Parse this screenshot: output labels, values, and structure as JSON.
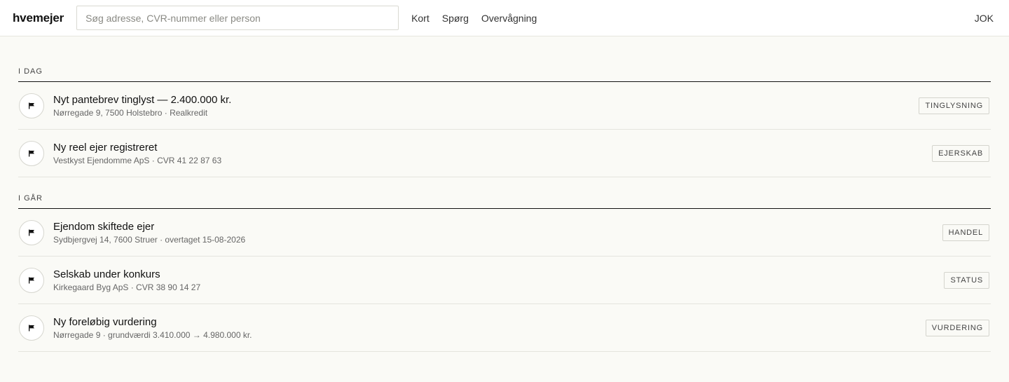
{
  "app": {
    "logo": "hvemejer",
    "search_placeholder": "Søg adresse, CVR-nummer eller person",
    "nav": [
      "Kort",
      "Spørg",
      "Overvågning"
    ],
    "user_initials": "JOK"
  },
  "groups": [
    {
      "label": "I DAG",
      "items": [
        {
          "title": "Nyt pantebrev tinglyst — 2.400.000 kr.",
          "sub": "Nørregade 9, 7500 Holstebro · Realkredit",
          "tag": "TINGLYSNING",
          "icon": "flag-icon"
        },
        {
          "title": "Ny reel ejer registreret",
          "sub": "Vestkyst Ejendomme ApS · CVR 41 22 87 63",
          "tag": "EJERSKAB",
          "icon": "flag-icon"
        }
      ]
    },
    {
      "label": "I GÅR",
      "items": [
        {
          "title": "Ejendom skiftede ejer",
          "sub": "Sydbjergvej 14, 7600 Struer · overtaget 15-08-2026",
          "tag": "HANDEL",
          "icon": "flag-icon"
        },
        {
          "title": "Selskab under konkurs",
          "sub": "Kirkegaard Byg ApS · CVR 38 90 14 27",
          "tag": "STATUS",
          "icon": "flag-icon"
        },
        {
          "title": "Ny foreløbig vurdering",
          "sub": "Nørregade 9 · grundværdi 3.410.000 → 4.980.000 kr.",
          "tag": "VURDERING",
          "icon": "flag-icon"
        }
      ]
    }
  ]
}
